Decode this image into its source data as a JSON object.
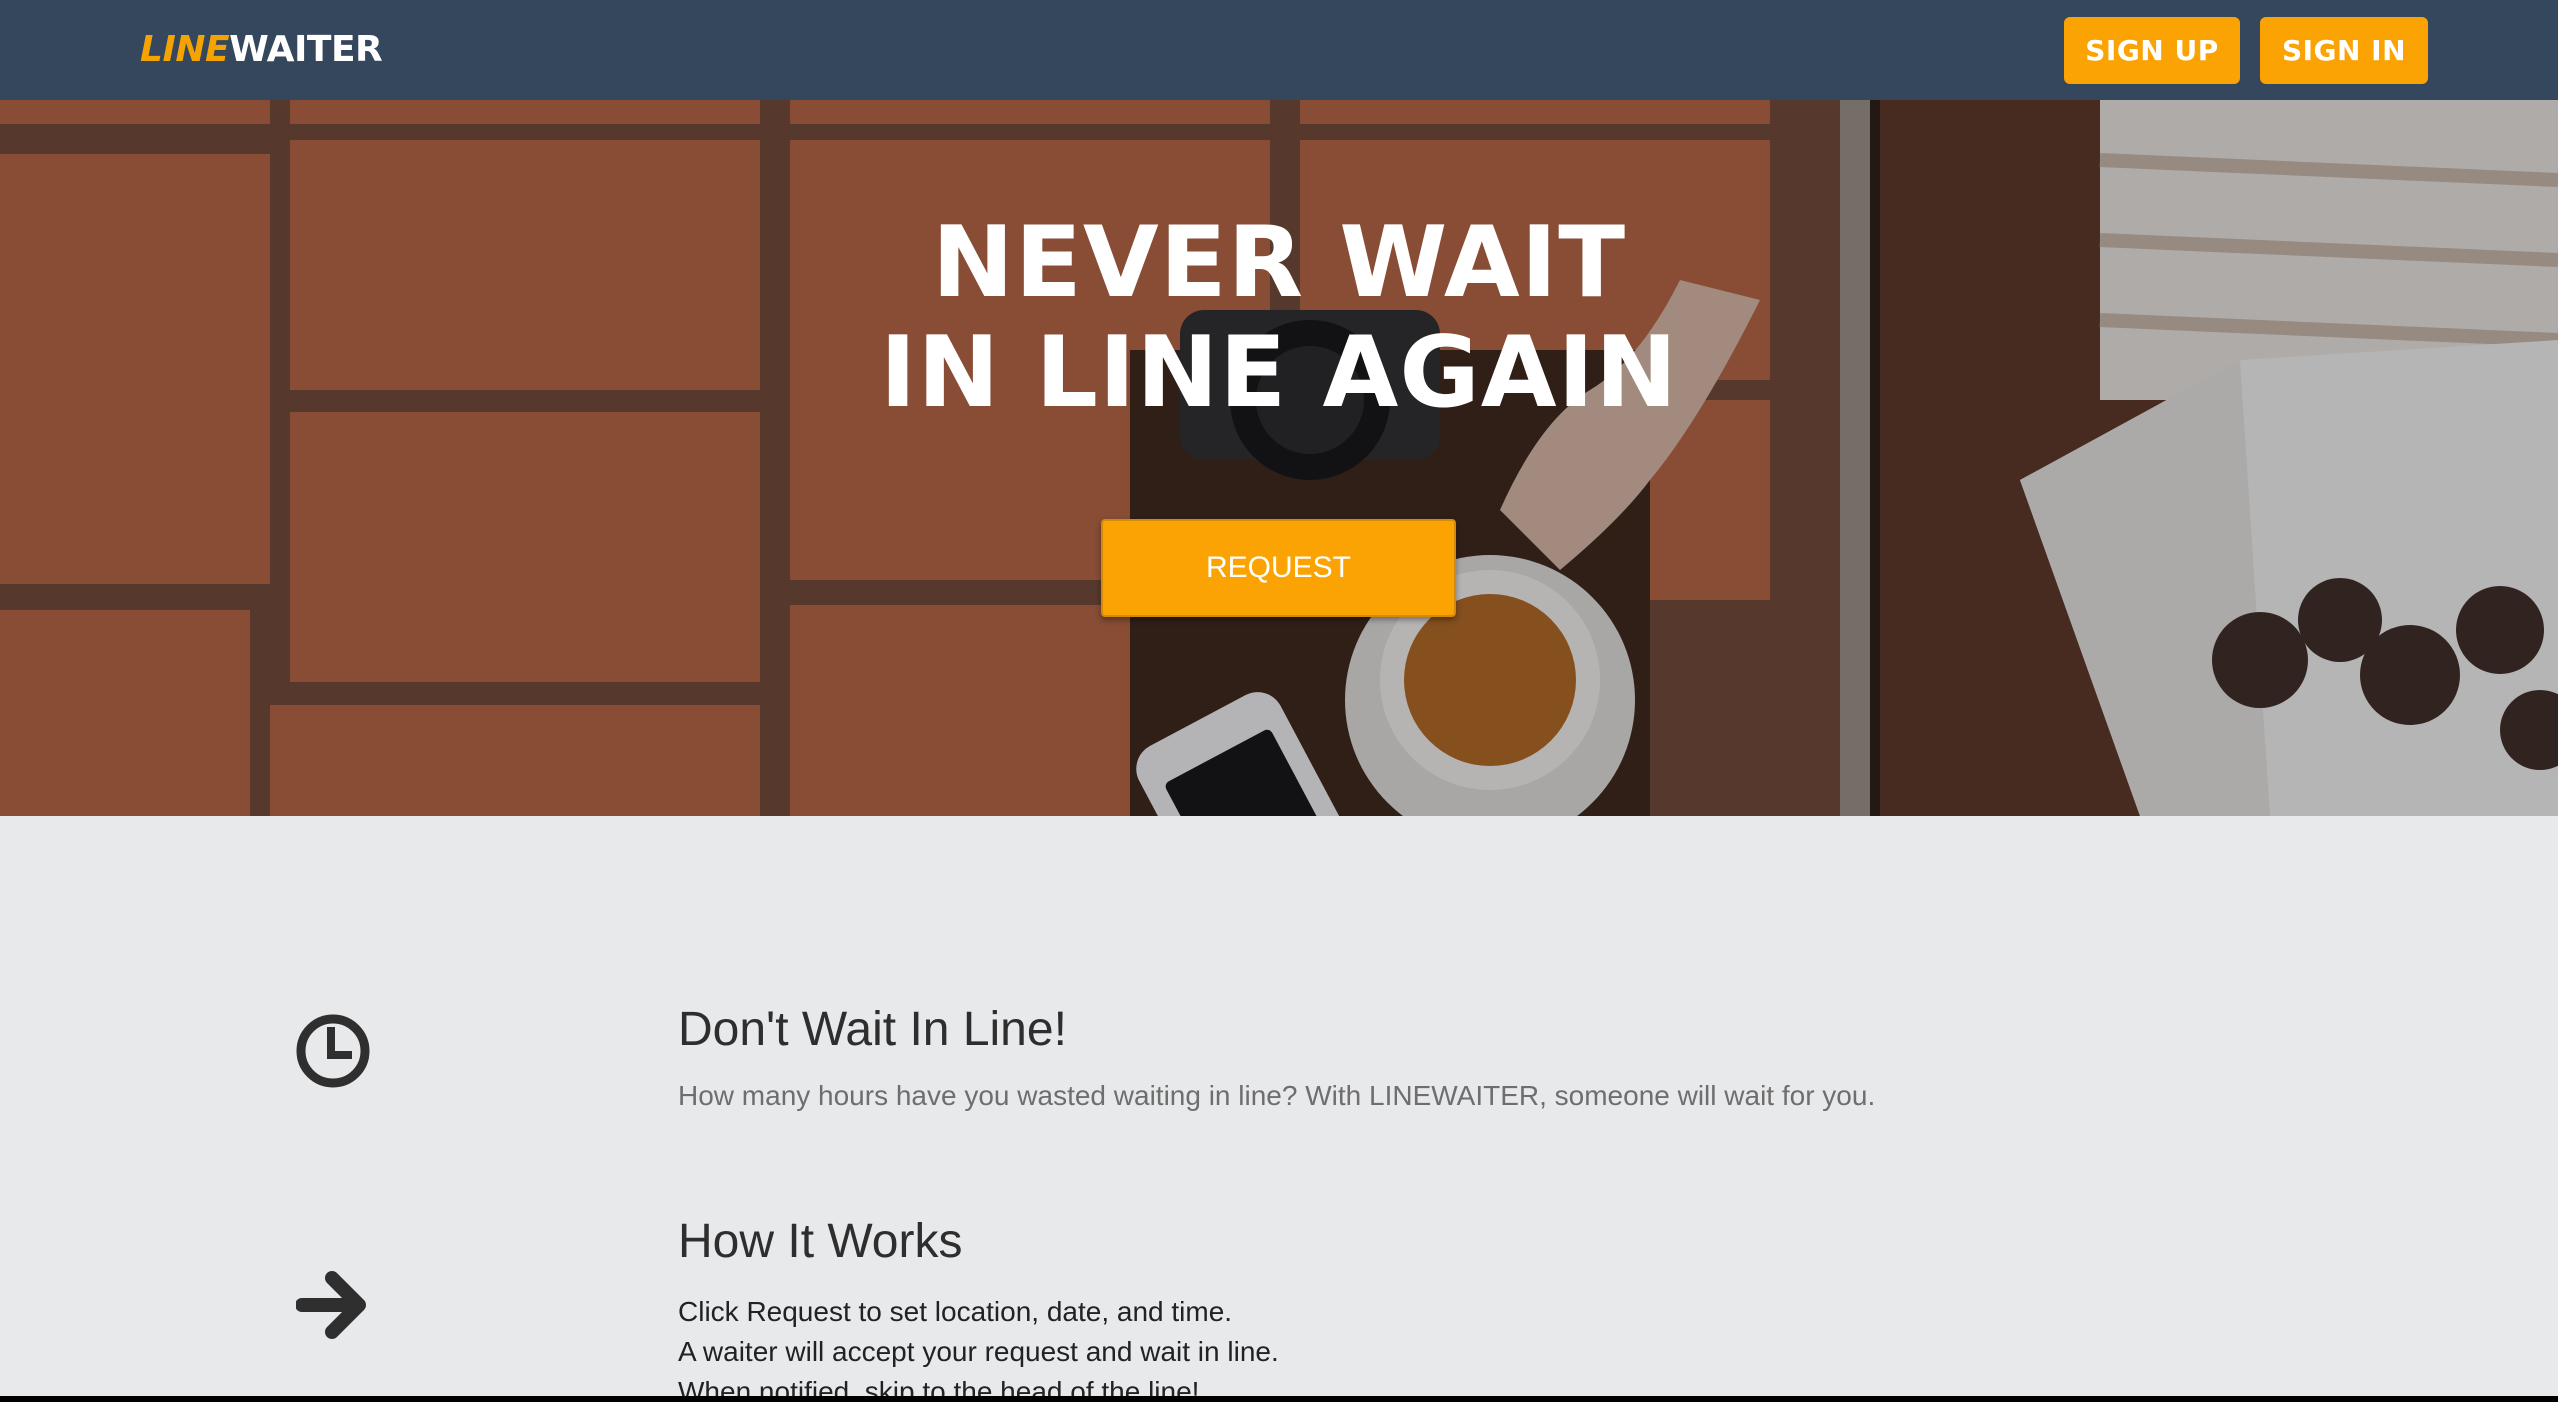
{
  "nav": {
    "logo_part1": "LINE",
    "logo_part2": "WAITER",
    "signup_label": "SIGN UP",
    "signin_label": "SIGN IN"
  },
  "hero": {
    "title_line1": "NEVER WAIT",
    "title_line2": "IN LINE AGAIN",
    "request_label": "REQUEST"
  },
  "features": [
    {
      "icon": "clock-icon",
      "title": "Don't Wait In Line!",
      "text": "How many hours have you wasted waiting in line? With LINEWAITER, someone will wait for you."
    },
    {
      "icon": "arrow-right-icon",
      "title": "How It Works",
      "steps": [
        "Click Request to set location, date, and time.",
        "A waiter will accept your request and wait in line.",
        "When notified, skip to the head of the line!"
      ]
    }
  ],
  "colors": {
    "nav_bg": "#34475c",
    "accent": "#fba302",
    "content_bg": "#e8e9eb"
  }
}
